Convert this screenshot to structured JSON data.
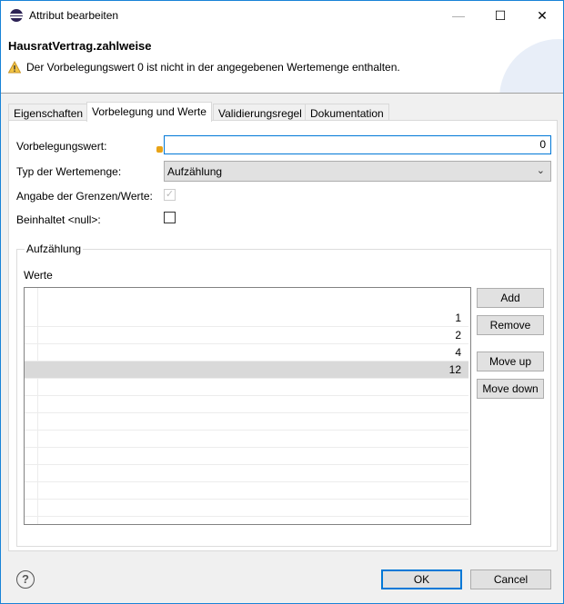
{
  "window": {
    "title": "Attribut bearbeiten",
    "minimize": "—",
    "maximize": "☐",
    "close": "✕"
  },
  "header": {
    "title": "HausratVertrag.zahlweise",
    "message": "Der Vorbelegungswert 0 ist nicht in der angegebenen Wertemenge enthalten."
  },
  "tabs": [
    {
      "label": "Eigenschaften"
    },
    {
      "label": "Vorbelegung und Werte",
      "active": true
    },
    {
      "label": "Validierungsregel"
    },
    {
      "label": "Dokumentation"
    }
  ],
  "form": {
    "default_label": "Vorbelegungswert:",
    "default_value": "0",
    "type_label": "Typ der Wertemenge:",
    "type_value": "Aufzählung",
    "limits_label": "Angabe der Grenzen/Werte:",
    "limits_checked": true,
    "null_label": "Beinhaltet <null>:",
    "null_checked": false
  },
  "group": {
    "title": "Aufzählung",
    "list_label": "Werte",
    "values": [
      "1",
      "2",
      "4",
      "12"
    ],
    "selected": "12"
  },
  "buttons": {
    "add": "Add",
    "remove": "Remove",
    "move_up": "Move up",
    "move_down": "Move down"
  },
  "footer": {
    "help": "?",
    "ok": "OK",
    "cancel": "Cancel"
  },
  "colors": {
    "accent": "#0078d7",
    "warning": "#e8a317"
  }
}
